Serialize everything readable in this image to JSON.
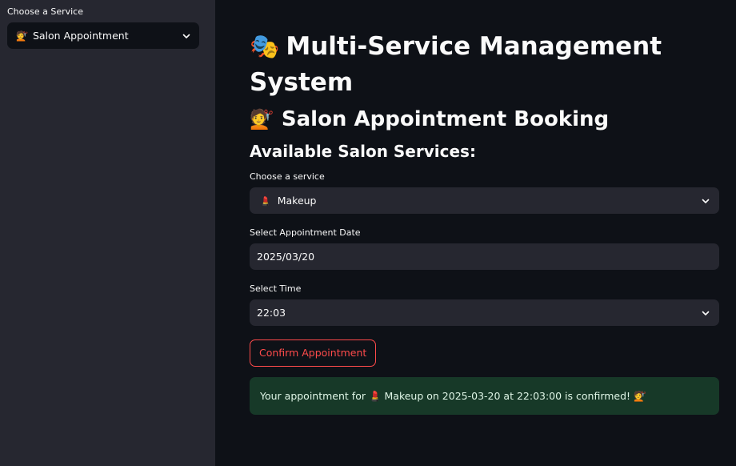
{
  "sidebar": {
    "label": "Choose a Service",
    "select": {
      "emoji": "💇",
      "value": "Salon Appointment"
    }
  },
  "main": {
    "title": {
      "emoji": "🎭",
      "text": "Multi-Service Management System"
    },
    "subtitle": {
      "emoji": "💇",
      "text": "Salon Appointment Booking"
    },
    "section": "Available Salon Services:",
    "service": {
      "label": "Choose a service",
      "emoji": "💄",
      "value": "Makeup"
    },
    "date": {
      "label": "Select Appointment Date",
      "value": "2025/03/20"
    },
    "time": {
      "label": "Select Time",
      "value": "22:03"
    },
    "confirm_button": "Confirm Appointment",
    "alert": {
      "text": "Your appointment for 💄 Makeup on 2025-03-20 at 22:03:00 is confirmed! 💇"
    }
  },
  "colors": {
    "background": "#0e1117",
    "sidebar": "#262730",
    "accent": "#ff4b4b",
    "success_bg": "#173928"
  }
}
